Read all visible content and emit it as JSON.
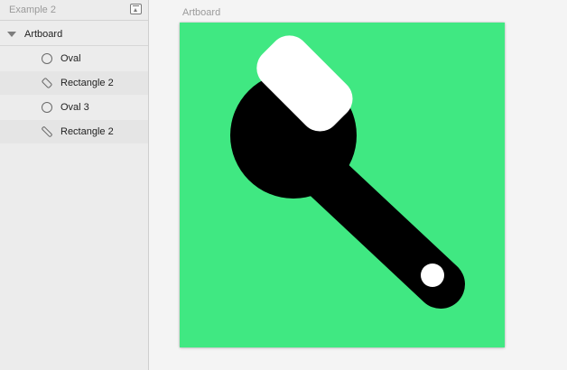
{
  "sidebar": {
    "page_name": "Example 2",
    "artboard_label": "Artboard",
    "layers": [
      {
        "label": "Oval",
        "icon": "oval-icon"
      },
      {
        "label": "Rectangle 2",
        "icon": "rectangle-icon"
      },
      {
        "label": "Oval 3",
        "icon": "oval-icon"
      },
      {
        "label": "Rectangle 2",
        "icon": "rectangle-icon"
      }
    ]
  },
  "canvas": {
    "artboard_title": "Artboard",
    "colors": {
      "artboard_bg": "#40E882",
      "shape_black": "#000000",
      "shape_white": "#FFFFFF"
    }
  }
}
